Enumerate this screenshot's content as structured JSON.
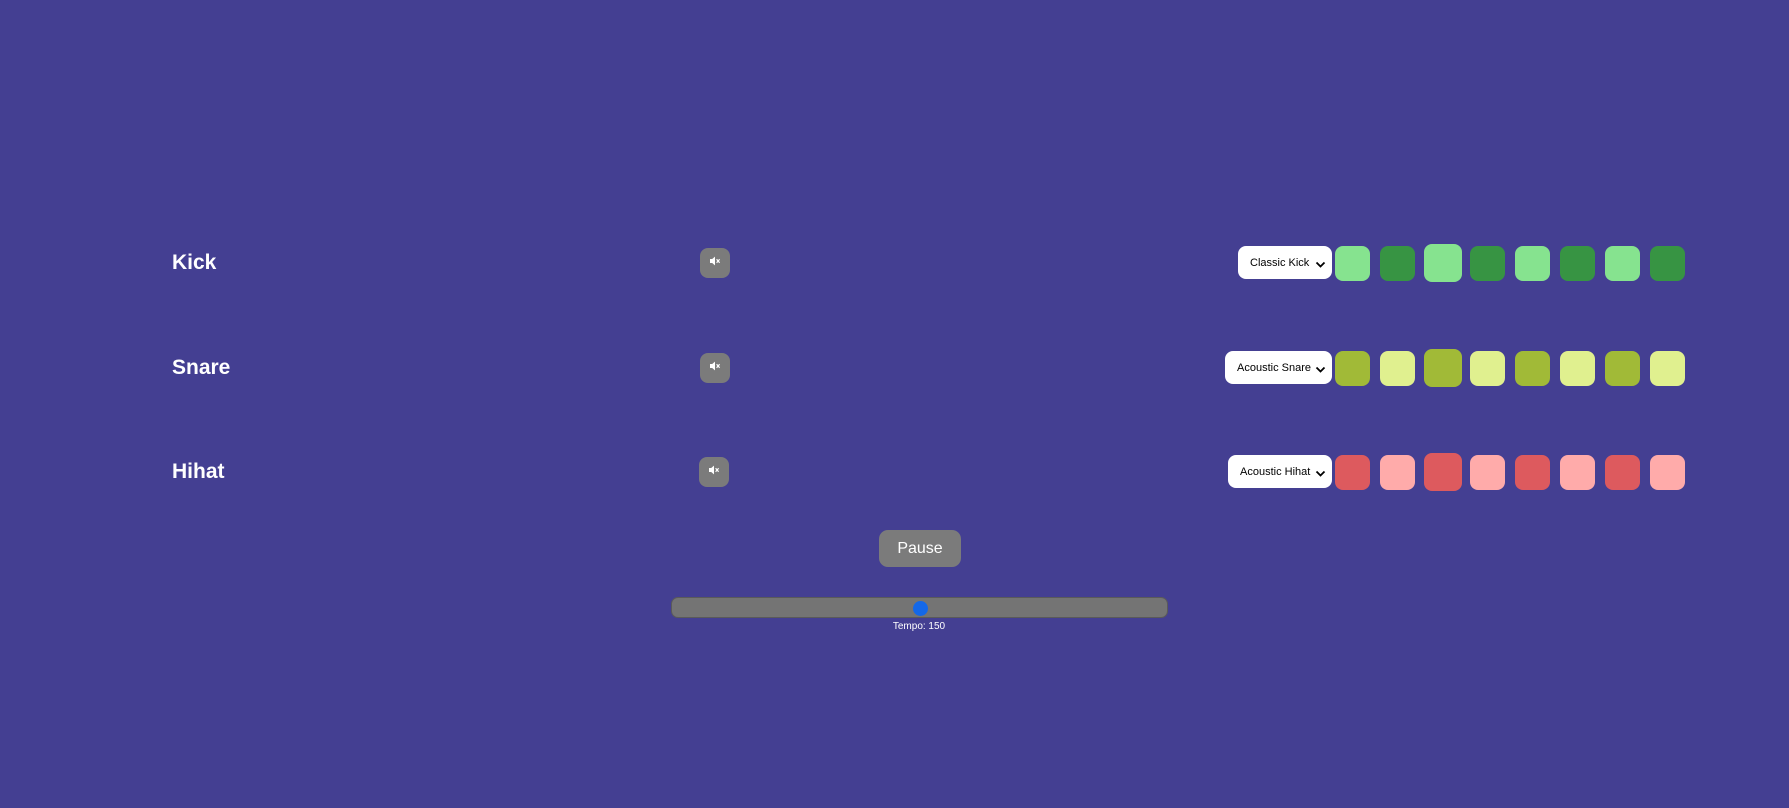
{
  "colors": {
    "background": "#443f92",
    "mute_button": "#7b7b7b",
    "slider_track": "#747474",
    "slider_thumb": "#1468e8"
  },
  "tracks": [
    {
      "name": "Kick",
      "mute_icon": "speaker-muted-icon",
      "sound": "Classic Kick",
      "sound_options": [
        "Classic Kick"
      ],
      "light_color": "#86e38f",
      "dark_color": "#379443",
      "steps": [
        true,
        false,
        true,
        false,
        true,
        false,
        true,
        false
      ]
    },
    {
      "name": "Snare",
      "mute_icon": "speaker-muted-icon",
      "sound": "Acoustic Snare",
      "sound_options": [
        "Acoustic Snare"
      ],
      "light_color": "#e0f08f",
      "dark_color": "#a1ba37",
      "steps": [
        false,
        true,
        false,
        true,
        false,
        true,
        false,
        true
      ]
    },
    {
      "name": "Hihat",
      "mute_icon": "speaker-muted-icon",
      "sound": "Acoustic Hihat",
      "sound_options": [
        "Acoustic Hihat"
      ],
      "light_color": "#ffabaa",
      "dark_color": "#dd5a5e",
      "steps": [
        false,
        true,
        false,
        true,
        false,
        true,
        false,
        true
      ]
    }
  ],
  "transport": {
    "pause_label": "Pause"
  },
  "tempo": {
    "label": "Tempo: 150",
    "value": 150,
    "position_fraction": 0.5
  }
}
